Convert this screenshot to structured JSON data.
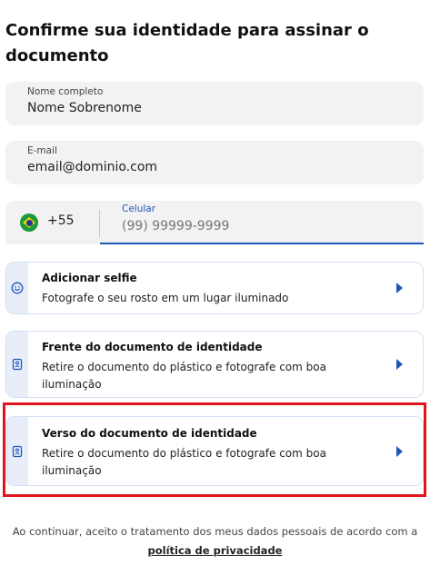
{
  "page": {
    "title": "Confirme sua identidade para assinar o documento"
  },
  "form": {
    "name": {
      "label": "Nome completo",
      "value": "Nome Sobrenome"
    },
    "email": {
      "label": "E-mail",
      "value": "email@dominio.com"
    },
    "phone": {
      "country_flag": "brazil-flag-icon",
      "country_code": "+55",
      "label": "Celular",
      "placeholder": "(99) 99999-9999"
    }
  },
  "cards": {
    "selfie": {
      "icon": "smiley-face-icon",
      "title": "Adicionar selfie",
      "description": "Fotografe o seu rosto em um lugar iluminado"
    },
    "front": {
      "icon": "id-document-icon",
      "title": "Frente do documento de identidade",
      "description": "Retire o documento do plástico e fotografe com boa iluminação"
    },
    "back": {
      "icon": "id-document-icon",
      "title": "Verso do documento de identidade",
      "description": "Retire o documento do plástico e fotografe com boa iluminação"
    }
  },
  "footer": {
    "text": "Ao continuar, aceito o tratamento dos meus dados pessoais de acordo com a",
    "link": "política de privacidade"
  },
  "colors": {
    "accent": "#1f56b8",
    "highlight": "#e0151e",
    "field_bg": "#f2f2f2",
    "card_strip": "#e7eef9"
  }
}
